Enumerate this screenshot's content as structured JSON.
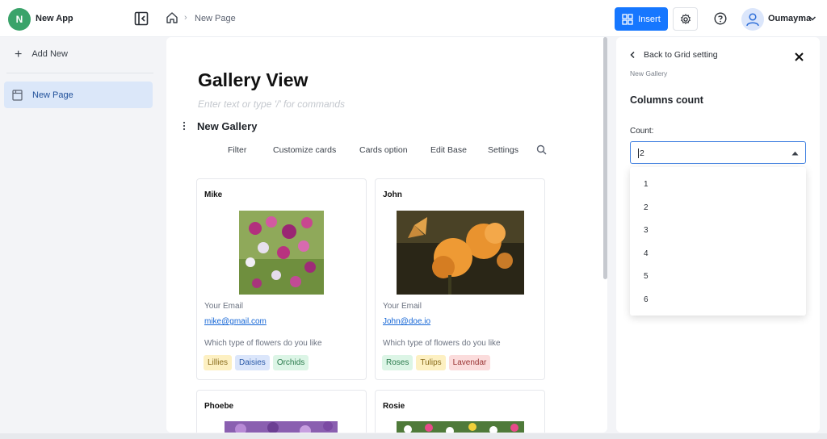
{
  "app": {
    "avatar_letter": "N",
    "name": "New App"
  },
  "breadcrumb": {
    "page": "New Page"
  },
  "header": {
    "insert_label": "Insert",
    "user_name": "Oumayma"
  },
  "sidebar": {
    "add_new_label": "Add New",
    "items": [
      {
        "label": "New Page"
      }
    ]
  },
  "main": {
    "title": "Gallery View",
    "placeholder": "Enter text or type '/' for commands",
    "gallery_title": "New Gallery",
    "toolbar": [
      "Filter",
      "Customize cards",
      "Cards option",
      "Edit Base",
      "Settings"
    ],
    "field_email_label": "Your Email",
    "field_flowers_label": "Which type of flowers do you like",
    "cards": [
      {
        "name": "Mike",
        "email": "mike@gmail.com",
        "tags": [
          "Lillies",
          "Daisies",
          "Orchids"
        ]
      },
      {
        "name": "John",
        "email": "John@doe.io",
        "tags": [
          "Roses",
          "Tulips",
          "Lavendar"
        ]
      },
      {
        "name": "Phoebe"
      },
      {
        "name": "Rosie"
      }
    ]
  },
  "panel": {
    "back_label": "Back to Grid setting",
    "sub_label": "New Gallery",
    "heading": "Columns count",
    "count_label": "Count:",
    "count_value": "2",
    "options": [
      "1",
      "2",
      "3",
      "4",
      "5",
      "6"
    ]
  },
  "colors": {
    "accent": "#1677ff",
    "avatar": "#3aa36a",
    "tag_yellow": "#fdf0c2",
    "tag_blue": "#dbe6fb",
    "tag_green": "#dcf5e6",
    "tag_red": "#fbdcdc"
  },
  "icons": [
    "collapse-sidebar-icon",
    "home-icon",
    "grid-insert-icon",
    "gear-icon",
    "help-icon",
    "user-icon",
    "chevron-down-icon",
    "plus-icon",
    "page-icon",
    "kebab-icon",
    "search-icon",
    "chevron-left-icon",
    "close-icon",
    "caret-up-icon"
  ]
}
